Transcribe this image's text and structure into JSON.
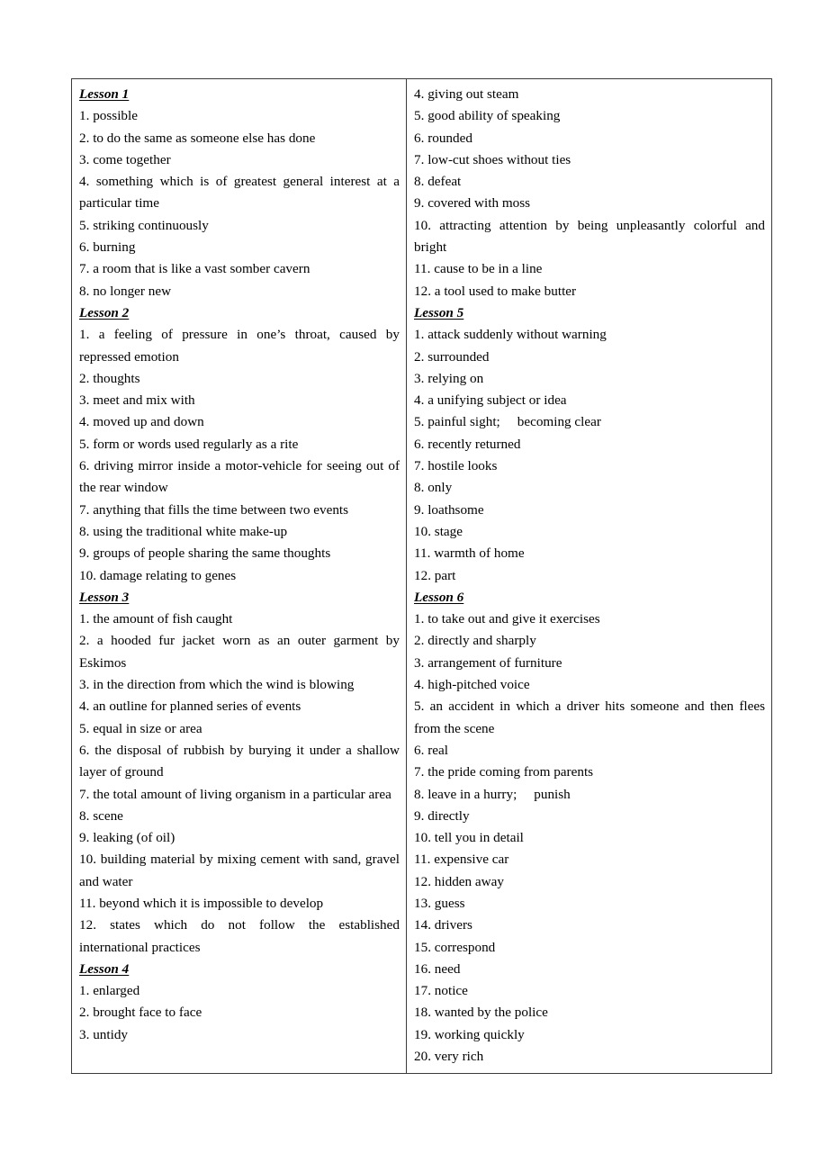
{
  "document": {
    "type": "vocabulary-answer-key",
    "page_background": "#ffffff",
    "border_color": "#3a3a3a",
    "columns": [
      {
        "name": "left-column",
        "blocks": [
          {
            "kind": "heading",
            "text": "Lesson 1"
          },
          {
            "kind": "item",
            "text": "1. possible"
          },
          {
            "kind": "item",
            "text": "2. to do the same as someone else has done"
          },
          {
            "kind": "item",
            "text": "3. come together"
          },
          {
            "kind": "item",
            "text": "4. something which is of greatest general interest at a particular time"
          },
          {
            "kind": "item",
            "text": "5. striking continuously"
          },
          {
            "kind": "item",
            "text": "6. burning"
          },
          {
            "kind": "item",
            "text": "7. a room that is like a vast somber cavern"
          },
          {
            "kind": "item",
            "text": "8. no longer new"
          },
          {
            "kind": "heading",
            "text": "Lesson 2"
          },
          {
            "kind": "item",
            "text": "1. a feeling of pressure in one’s throat, caused by repressed emotion"
          },
          {
            "kind": "item",
            "text": "2. thoughts"
          },
          {
            "kind": "item",
            "text": "3. meet and mix with"
          },
          {
            "kind": "item",
            "text": "4. moved up and down"
          },
          {
            "kind": "item",
            "text": "5. form or words used regularly as a rite"
          },
          {
            "kind": "item",
            "text": "6. driving mirror inside a motor-vehicle for seeing out of the rear window"
          },
          {
            "kind": "item",
            "text": "7. anything that fills the time between two events"
          },
          {
            "kind": "item",
            "text": "8. using the traditional white make-up"
          },
          {
            "kind": "item",
            "text": "9. groups of people sharing the same thoughts"
          },
          {
            "kind": "item",
            "text": "10. damage relating to genes"
          },
          {
            "kind": "heading",
            "text": "Lesson 3"
          },
          {
            "kind": "item",
            "text": "1. the amount of fish caught"
          },
          {
            "kind": "item",
            "text": "2. a hooded fur jacket worn as an outer garment by Eskimos"
          },
          {
            "kind": "item",
            "text": "3. in the direction from which the wind is blowing"
          },
          {
            "kind": "item",
            "text": "4. an outline for planned series of events"
          },
          {
            "kind": "item",
            "text": "5. equal in size or area"
          },
          {
            "kind": "item",
            "text": "6. the disposal of rubbish by burying it under a shallow layer of ground"
          },
          {
            "kind": "item",
            "text": "7. the total amount of living organism in a particular area"
          },
          {
            "kind": "item",
            "text": "8. scene"
          },
          {
            "kind": "item",
            "text": "9. leaking (of oil)"
          },
          {
            "kind": "item",
            "text": "10. building material by mixing cement with sand, gravel and water"
          },
          {
            "kind": "item",
            "text": "11. beyond which it is impossible to develop"
          },
          {
            "kind": "item",
            "text": "12. states which do not follow the established international practices"
          },
          {
            "kind": "heading",
            "text": "Lesson 4"
          },
          {
            "kind": "item",
            "text": "1. enlarged"
          },
          {
            "kind": "item",
            "text": "2. brought face to face"
          },
          {
            "kind": "item",
            "text": "3. untidy"
          }
        ]
      },
      {
        "name": "right-column",
        "blocks": [
          {
            "kind": "item",
            "text": "4. giving out steam"
          },
          {
            "kind": "item",
            "text": "5. good ability of speaking"
          },
          {
            "kind": "item",
            "text": "6. rounded"
          },
          {
            "kind": "item",
            "text": "7. low-cut shoes without ties"
          },
          {
            "kind": "item",
            "text": "8. defeat"
          },
          {
            "kind": "item",
            "text": "9. covered with moss"
          },
          {
            "kind": "item",
            "text": "10. attracting attention by being unpleasantly colorful and bright"
          },
          {
            "kind": "item",
            "text": "11. cause to be in a line"
          },
          {
            "kind": "item",
            "text": "12. a tool used to make butter"
          },
          {
            "kind": "heading",
            "text": "Lesson 5"
          },
          {
            "kind": "item",
            "text": "1. attack suddenly without warning"
          },
          {
            "kind": "item",
            "text": "2. surrounded"
          },
          {
            "kind": "item",
            "text": "3. relying on"
          },
          {
            "kind": "item",
            "text": "4. a unifying subject or idea"
          },
          {
            "kind": "item",
            "text": "5. painful sight;     becoming clear"
          },
          {
            "kind": "item",
            "text": "6. recently returned"
          },
          {
            "kind": "item",
            "text": "7. hostile looks"
          },
          {
            "kind": "item",
            "text": "8. only"
          },
          {
            "kind": "item",
            "text": "9. loathsome"
          },
          {
            "kind": "item",
            "text": "10. stage"
          },
          {
            "kind": "item",
            "text": "11. warmth of home"
          },
          {
            "kind": "item",
            "text": "12. part"
          },
          {
            "kind": "heading",
            "text": "Lesson 6"
          },
          {
            "kind": "item",
            "text": "1. to take out and give it exercises"
          },
          {
            "kind": "item",
            "text": "2. directly and sharply"
          },
          {
            "kind": "item",
            "text": "3. arrangement of furniture"
          },
          {
            "kind": "item",
            "text": "4. high-pitched voice"
          },
          {
            "kind": "item",
            "text": "5. an accident in which a driver hits someone and then flees from the scene"
          },
          {
            "kind": "item",
            "text": "6. real"
          },
          {
            "kind": "item",
            "text": "7. the pride coming from parents"
          },
          {
            "kind": "item",
            "text": "8. leave in a hurry;     punish"
          },
          {
            "kind": "item",
            "text": "9. directly"
          },
          {
            "kind": "item",
            "text": "10. tell you in detail"
          },
          {
            "kind": "item",
            "text": "11. expensive car"
          },
          {
            "kind": "item",
            "text": "12. hidden away"
          },
          {
            "kind": "item",
            "text": "13. guess"
          },
          {
            "kind": "item",
            "text": "14. drivers"
          },
          {
            "kind": "item",
            "text": "15. correspond"
          },
          {
            "kind": "item",
            "text": "16. need"
          },
          {
            "kind": "item",
            "text": "17. notice"
          },
          {
            "kind": "item",
            "text": "18. wanted by the police"
          },
          {
            "kind": "item",
            "text": "19. working quickly"
          },
          {
            "kind": "item",
            "text": "20. very rich"
          }
        ]
      }
    ]
  }
}
